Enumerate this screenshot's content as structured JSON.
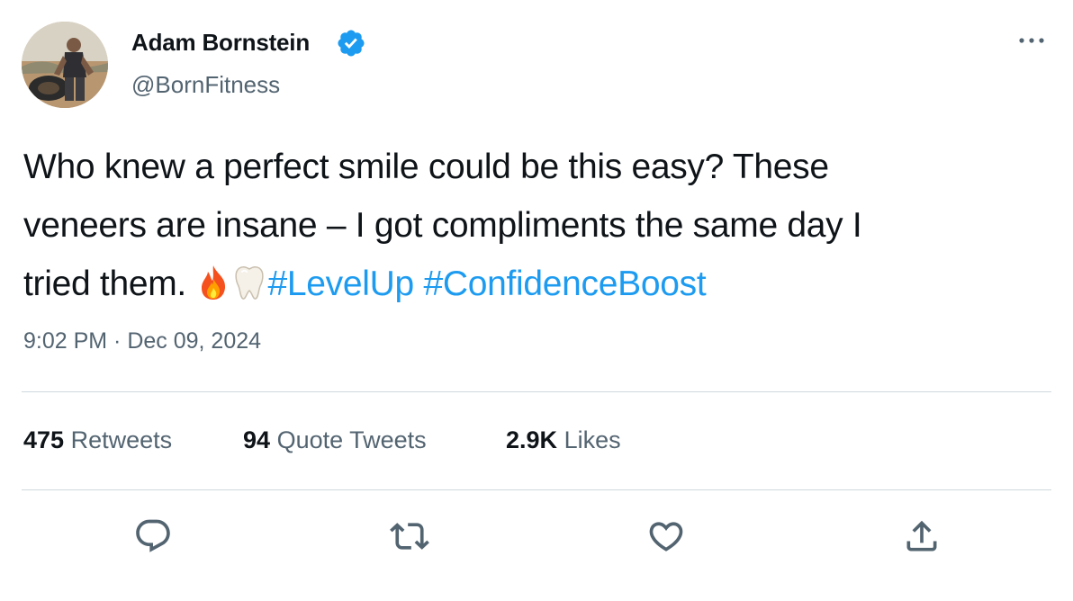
{
  "author": {
    "name": "Adam Bornstein",
    "handle": "@BornFitness",
    "verified": true,
    "verified_color": "#1d9bf0"
  },
  "tweet": {
    "line1": "Who knew a perfect smile could be this easy? These",
    "line2": "veneers are insane – I got compliments the same day I",
    "line3": "tried them.",
    "emojis": [
      "fire-emoji",
      "tooth-emoji"
    ],
    "hashtags": [
      "#LevelUp",
      "#ConfidenceBoost"
    ],
    "link_color": "#1d9bf0"
  },
  "timestamp": "9:02 PM · Dec 09, 2024",
  "stats": {
    "retweets_count": "475",
    "retweets_label": "Retweets",
    "quotes_count": "94",
    "quotes_label": "Quote Tweets",
    "likes_count": "2.9K",
    "likes_label": "Likes"
  },
  "actions": [
    "reply-icon",
    "retweet-icon",
    "like-icon",
    "share-icon"
  ],
  "colors": {
    "text": "#0f1419",
    "secondary": "#536471",
    "divider": "#cfd9de"
  }
}
